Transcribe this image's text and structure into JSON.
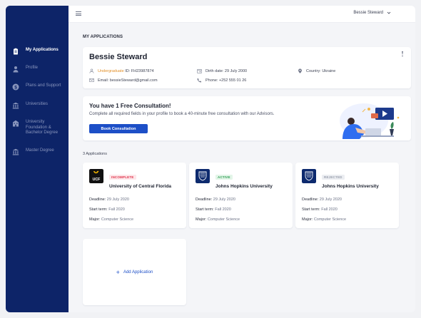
{
  "sidebar": {
    "items": [
      {
        "label": "My Applications",
        "icon": "clipboard-icon"
      },
      {
        "label": "Profile",
        "icon": "person-icon"
      },
      {
        "label": "Plans and Support",
        "icon": "dollar-icon"
      },
      {
        "label": "Universities",
        "icon": "university-icon"
      },
      {
        "label": "University\nFoundation &\nBachelor Degree",
        "icon": "building-icon"
      },
      {
        "label": "Master Degree",
        "icon": "university-icon"
      }
    ]
  },
  "topbar": {
    "user_name": "Bessie Steward"
  },
  "main": {
    "section_title": "MY APPLICATIONS"
  },
  "profile": {
    "name": "Bessie Steward",
    "level": "Undergraduate",
    "id_label": "ID: FH23987874",
    "email": "Email: bessieSteward@gmail.com",
    "birth": "Dirth date: 29 July 2000",
    "phone": "Phone: +252 555 01 26",
    "country": "Country: Ukraine"
  },
  "consultation": {
    "title": "You have 1 Free Consultation!",
    "text": "Complete all required fields in your profile to book a 40-minute free consultation with our Advisors.",
    "button": "Book Consultation"
  },
  "applications": {
    "count_label": "3 Applications",
    "labels": {
      "deadline": "Deadline:",
      "start": "Start term:",
      "major": "Major:"
    },
    "items": [
      {
        "status": "INCOMPLETE",
        "status_color": "#e0344b",
        "status_bg": "#fde7ea",
        "university": "University of Central Florida",
        "logo": "ucf-logo",
        "logo_text": "UCF",
        "deadline": "29 July 2020",
        "start": "Fall 2020",
        "major": "Computer Science"
      },
      {
        "status": "ACTIVE",
        "status_color": "#2f9e53",
        "status_bg": "#e3f5e8",
        "university": "Johns Hopkins University",
        "logo": "jhu-shield-logo",
        "deadline": "29 July 2020",
        "start": "Fall 2020",
        "major": "Computer Science"
      },
      {
        "status": "REJECTED",
        "status_color": "#9aa0ae",
        "status_bg": "#eceef2",
        "university": "Johns Hopkins University",
        "logo": "jhu-shield-logo",
        "deadline": "29 July 2020",
        "start": "Fall 2020",
        "major": "Computer Science"
      }
    ],
    "add_label": "Add Application"
  },
  "colors": {
    "sidebar": "#0d2468",
    "accent": "#1d4fc7",
    "orange": "#e2902a"
  }
}
